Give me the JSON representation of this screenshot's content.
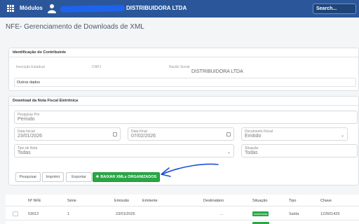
{
  "topbar": {
    "modules_label": "Módulos",
    "company_name": "DISTRIBUIDORA LTDA",
    "search_placeholder": "Search...",
    "user_icon": "user-icon",
    "modules_icon": "grid-icon"
  },
  "page_title": "NFE- Gerenciamento de Downloads de XML",
  "contribuinte": {
    "header": "Identificação do Contribuinte",
    "inscricao_label": "Inscrição Estadual",
    "cnpj_label": "CNPJ",
    "razao_label": "Razão Social",
    "razao_value": "DISTRIBUIDORA LTDA",
    "outros_dados": "Outros dados"
  },
  "download": {
    "header": "Download da Nota Fiscal Eletrônica",
    "pesquisar_por_label": "Pesquisar Por",
    "pesquisar_por_value": "Período",
    "data_inicial_label": "Data Inicial",
    "data_inicial_value": "23/01/2026",
    "data_final_label": "Data Final",
    "data_final_value": "07/02/2026",
    "documento_fiscal_label": "Documento Fiscal",
    "documento_fiscal_value": "Emitido",
    "tipo_nota_label": "Tipo de Nota",
    "tipo_nota_value": "Todas",
    "situacao_label": "Situação",
    "situacao_value": "Todas"
  },
  "buttons": {
    "pesquisar": "Pesquisar",
    "imprimir": "Imprimir",
    "exportar": "Exportar",
    "baixar": "BAIXAR XMLs ORGANIZADOS"
  },
  "table": {
    "headers": [
      "Nº NFE",
      "Série",
      "Emissão",
      "Emitente",
      "Destinatário",
      "Situação",
      "Tipo",
      "Chave"
    ],
    "rows": [
      [
        "53012",
        "1",
        "23/01/2026",
        "",
        "...",
        "Autorizada",
        "Saída",
        "122601425"
      ]
    ]
  },
  "colors": {
    "topbar": "#2b579a",
    "accent_green": "#28a745",
    "annotation_arrow": "#1d4fd6"
  }
}
